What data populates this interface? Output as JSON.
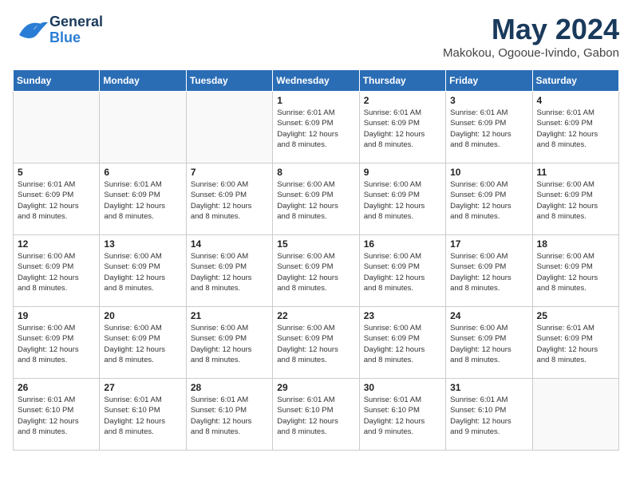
{
  "header": {
    "logo_general": "General",
    "logo_blue": "Blue",
    "month_year": "May 2024",
    "location": "Makokou, Ogooue-Ivindo, Gabon"
  },
  "days_of_week": [
    "Sunday",
    "Monday",
    "Tuesday",
    "Wednesday",
    "Thursday",
    "Friday",
    "Saturday"
  ],
  "weeks": [
    [
      {
        "day": "",
        "info": ""
      },
      {
        "day": "",
        "info": ""
      },
      {
        "day": "",
        "info": ""
      },
      {
        "day": "1",
        "info": "Sunrise: 6:01 AM\nSunset: 6:09 PM\nDaylight: 12 hours\nand 8 minutes."
      },
      {
        "day": "2",
        "info": "Sunrise: 6:01 AM\nSunset: 6:09 PM\nDaylight: 12 hours\nand 8 minutes."
      },
      {
        "day": "3",
        "info": "Sunrise: 6:01 AM\nSunset: 6:09 PM\nDaylight: 12 hours\nand 8 minutes."
      },
      {
        "day": "4",
        "info": "Sunrise: 6:01 AM\nSunset: 6:09 PM\nDaylight: 12 hours\nand 8 minutes."
      }
    ],
    [
      {
        "day": "5",
        "info": "Sunrise: 6:01 AM\nSunset: 6:09 PM\nDaylight: 12 hours\nand 8 minutes."
      },
      {
        "day": "6",
        "info": "Sunrise: 6:01 AM\nSunset: 6:09 PM\nDaylight: 12 hours\nand 8 minutes."
      },
      {
        "day": "7",
        "info": "Sunrise: 6:00 AM\nSunset: 6:09 PM\nDaylight: 12 hours\nand 8 minutes."
      },
      {
        "day": "8",
        "info": "Sunrise: 6:00 AM\nSunset: 6:09 PM\nDaylight: 12 hours\nand 8 minutes."
      },
      {
        "day": "9",
        "info": "Sunrise: 6:00 AM\nSunset: 6:09 PM\nDaylight: 12 hours\nand 8 minutes."
      },
      {
        "day": "10",
        "info": "Sunrise: 6:00 AM\nSunset: 6:09 PM\nDaylight: 12 hours\nand 8 minutes."
      },
      {
        "day": "11",
        "info": "Sunrise: 6:00 AM\nSunset: 6:09 PM\nDaylight: 12 hours\nand 8 minutes."
      }
    ],
    [
      {
        "day": "12",
        "info": "Sunrise: 6:00 AM\nSunset: 6:09 PM\nDaylight: 12 hours\nand 8 minutes."
      },
      {
        "day": "13",
        "info": "Sunrise: 6:00 AM\nSunset: 6:09 PM\nDaylight: 12 hours\nand 8 minutes."
      },
      {
        "day": "14",
        "info": "Sunrise: 6:00 AM\nSunset: 6:09 PM\nDaylight: 12 hours\nand 8 minutes."
      },
      {
        "day": "15",
        "info": "Sunrise: 6:00 AM\nSunset: 6:09 PM\nDaylight: 12 hours\nand 8 minutes."
      },
      {
        "day": "16",
        "info": "Sunrise: 6:00 AM\nSunset: 6:09 PM\nDaylight: 12 hours\nand 8 minutes."
      },
      {
        "day": "17",
        "info": "Sunrise: 6:00 AM\nSunset: 6:09 PM\nDaylight: 12 hours\nand 8 minutes."
      },
      {
        "day": "18",
        "info": "Sunrise: 6:00 AM\nSunset: 6:09 PM\nDaylight: 12 hours\nand 8 minutes."
      }
    ],
    [
      {
        "day": "19",
        "info": "Sunrise: 6:00 AM\nSunset: 6:09 PM\nDaylight: 12 hours\nand 8 minutes."
      },
      {
        "day": "20",
        "info": "Sunrise: 6:00 AM\nSunset: 6:09 PM\nDaylight: 12 hours\nand 8 minutes."
      },
      {
        "day": "21",
        "info": "Sunrise: 6:00 AM\nSunset: 6:09 PM\nDaylight: 12 hours\nand 8 minutes."
      },
      {
        "day": "22",
        "info": "Sunrise: 6:00 AM\nSunset: 6:09 PM\nDaylight: 12 hours\nand 8 minutes."
      },
      {
        "day": "23",
        "info": "Sunrise: 6:00 AM\nSunset: 6:09 PM\nDaylight: 12 hours\nand 8 minutes."
      },
      {
        "day": "24",
        "info": "Sunrise: 6:00 AM\nSunset: 6:09 PM\nDaylight: 12 hours\nand 8 minutes."
      },
      {
        "day": "25",
        "info": "Sunrise: 6:01 AM\nSunset: 6:09 PM\nDaylight: 12 hours\nand 8 minutes."
      }
    ],
    [
      {
        "day": "26",
        "info": "Sunrise: 6:01 AM\nSunset: 6:10 PM\nDaylight: 12 hours\nand 8 minutes."
      },
      {
        "day": "27",
        "info": "Sunrise: 6:01 AM\nSunset: 6:10 PM\nDaylight: 12 hours\nand 8 minutes."
      },
      {
        "day": "28",
        "info": "Sunrise: 6:01 AM\nSunset: 6:10 PM\nDaylight: 12 hours\nand 8 minutes."
      },
      {
        "day": "29",
        "info": "Sunrise: 6:01 AM\nSunset: 6:10 PM\nDaylight: 12 hours\nand 8 minutes."
      },
      {
        "day": "30",
        "info": "Sunrise: 6:01 AM\nSunset: 6:10 PM\nDaylight: 12 hours\nand 9 minutes."
      },
      {
        "day": "31",
        "info": "Sunrise: 6:01 AM\nSunset: 6:10 PM\nDaylight: 12 hours\nand 9 minutes."
      },
      {
        "day": "",
        "info": ""
      }
    ]
  ]
}
